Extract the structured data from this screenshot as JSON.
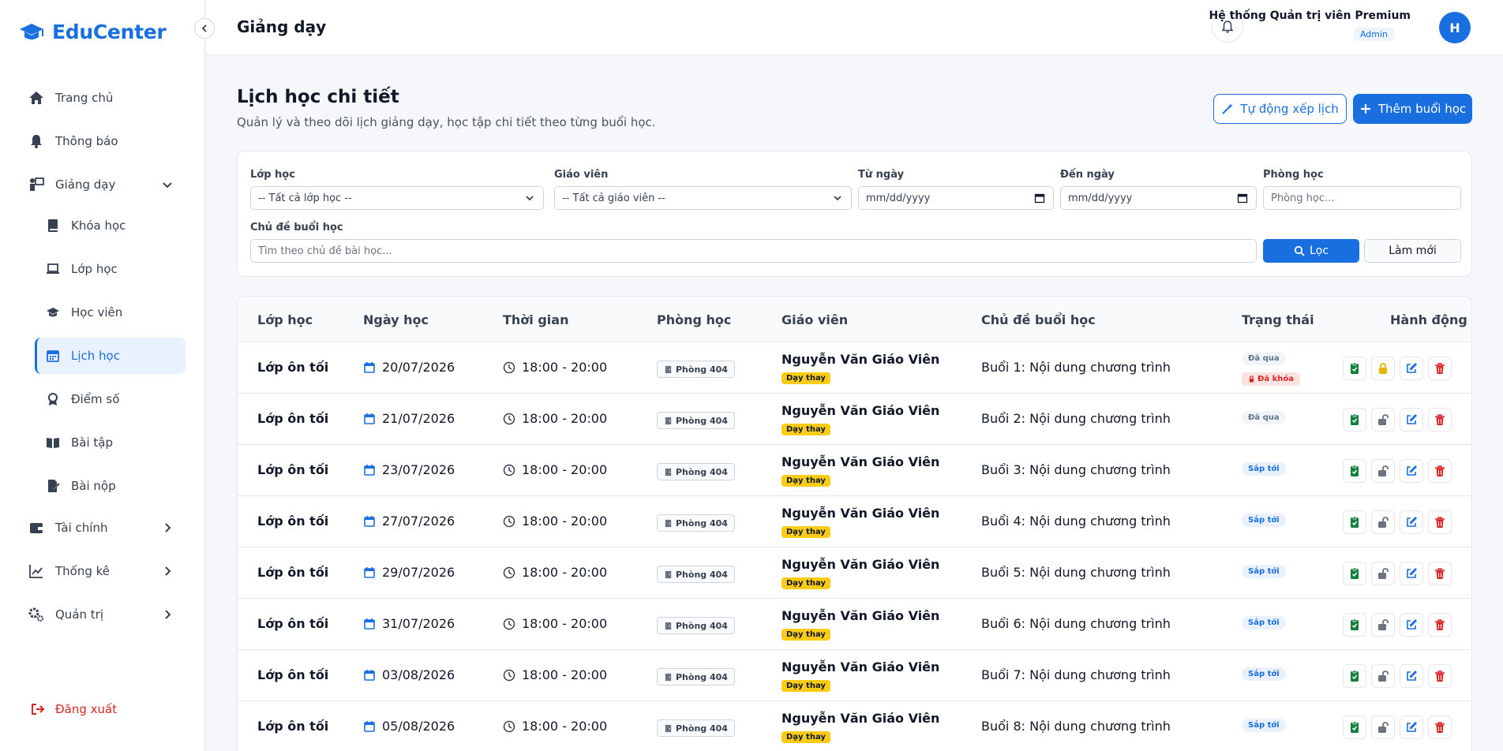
{
  "app": {
    "name": "EduCenter"
  },
  "header": {
    "title": "Giảng dạy",
    "user_name": "Hệ thống Quản trị viên Premium",
    "user_role": "Admin",
    "avatar_letter": "H"
  },
  "sidebar": {
    "items": [
      {
        "label": "Trang chủ",
        "icon": "home-icon"
      },
      {
        "label": "Thông báo",
        "icon": "bell-icon"
      },
      {
        "label": "Giảng dạy",
        "icon": "teach-icon"
      },
      {
        "label": "Tài chính",
        "icon": "wallet-icon"
      },
      {
        "label": "Thống kê",
        "icon": "chart-icon"
      },
      {
        "label": "Quản trị",
        "icon": "gears-icon"
      }
    ],
    "sub_items": [
      {
        "label": "Khóa học",
        "icon": "book-icon"
      },
      {
        "label": "Lớp học",
        "icon": "laptop-icon"
      },
      {
        "label": "Học viên",
        "icon": "graduation-cap-icon"
      },
      {
        "label": "Lịch học",
        "icon": "calendar-icon"
      },
      {
        "label": "Điểm số",
        "icon": "award-icon"
      },
      {
        "label": "Bài tập",
        "icon": "open-book-icon"
      },
      {
        "label": "Bài nộp",
        "icon": "file-edit-icon"
      }
    ],
    "logout": "Đăng xuất"
  },
  "page": {
    "title": "Lịch học chi tiết",
    "subtitle": "Quản lý và theo dõi lịch giảng dạy, học tập chi tiết theo từng buổi học.",
    "btn_auto": "Tự động xếp lịch",
    "btn_add": "Thêm buổi học"
  },
  "filters": {
    "class_label": "Lớp học",
    "class_value": "-- Tất cả lớp học --",
    "teacher_label": "Giáo viên",
    "teacher_value": "-- Tất cả giáo viên --",
    "from_label": "Từ ngày",
    "from_placeholder": "mm/dd/yyyy",
    "to_label": "Đến ngày",
    "to_placeholder": "mm/dd/yyyy",
    "room_label": "Phòng học",
    "room_placeholder": "Phòng học...",
    "topic_label": "Chủ đề buổi học",
    "topic_placeholder": "Tìm theo chủ đề bài học...",
    "btn_filter": "Lọc",
    "btn_reset": "Làm mới"
  },
  "table": {
    "headers": [
      "Lớp học",
      "Ngày học",
      "Thời gian",
      "Phòng học",
      "Giáo viên",
      "Chủ đề buổi học",
      "Trạng thái",
      "Hành động"
    ],
    "substitute_tag": "Dạy thay",
    "locked_label": "Đã khóa",
    "rows": [
      {
        "class": "Lớp ôn tối",
        "date": "20/07/2026",
        "time": "18:00 - 20:00",
        "room": "Phòng 404",
        "teacher": "Nguyễn Văn Giáo Viên",
        "topic": "Buổi 1: Nội dung chương trình",
        "status": "Đã qua",
        "locked": true
      },
      {
        "class": "Lớp ôn tối",
        "date": "21/07/2026",
        "time": "18:00 - 20:00",
        "room": "Phòng 404",
        "teacher": "Nguyễn Văn Giáo Viên",
        "topic": "Buổi 2: Nội dung chương trình",
        "status": "Đã qua",
        "locked": false
      },
      {
        "class": "Lớp ôn tối",
        "date": "23/07/2026",
        "time": "18:00 - 20:00",
        "room": "Phòng 404",
        "teacher": "Nguyễn Văn Giáo Viên",
        "topic": "Buổi 3: Nội dung chương trình",
        "status": "Sắp tới",
        "locked": false
      },
      {
        "class": "Lớp ôn tối",
        "date": "27/07/2026",
        "time": "18:00 - 20:00",
        "room": "Phòng 404",
        "teacher": "Nguyễn Văn Giáo Viên",
        "topic": "Buổi 4: Nội dung chương trình",
        "status": "Sắp tới",
        "locked": false
      },
      {
        "class": "Lớp ôn tối",
        "date": "29/07/2026",
        "time": "18:00 - 20:00",
        "room": "Phòng 404",
        "teacher": "Nguyễn Văn Giáo Viên",
        "topic": "Buổi 5: Nội dung chương trình",
        "status": "Sắp tới",
        "locked": false
      },
      {
        "class": "Lớp ôn tối",
        "date": "31/07/2026",
        "time": "18:00 - 20:00",
        "room": "Phòng 404",
        "teacher": "Nguyễn Văn Giáo Viên",
        "topic": "Buổi 6: Nội dung chương trình",
        "status": "Sắp tới",
        "locked": false
      },
      {
        "class": "Lớp ôn tối",
        "date": "03/08/2026",
        "time": "18:00 - 20:00",
        "room": "Phòng 404",
        "teacher": "Nguyễn Văn Giáo Viên",
        "topic": "Buổi 7: Nội dung chương trình",
        "status": "Sắp tới",
        "locked": false
      },
      {
        "class": "Lớp ôn tối",
        "date": "05/08/2026",
        "time": "18:00 - 20:00",
        "room": "Phòng 404",
        "teacher": "Nguyễn Văn Giáo Viên",
        "topic": "Buổi 8: Nội dung chương trình",
        "status": "Sắp tới",
        "locked": false
      }
    ]
  },
  "colors": {
    "primary": "#1a6fe0",
    "danger": "#dc2626",
    "success": "#15803d",
    "warning": "#eab308"
  }
}
